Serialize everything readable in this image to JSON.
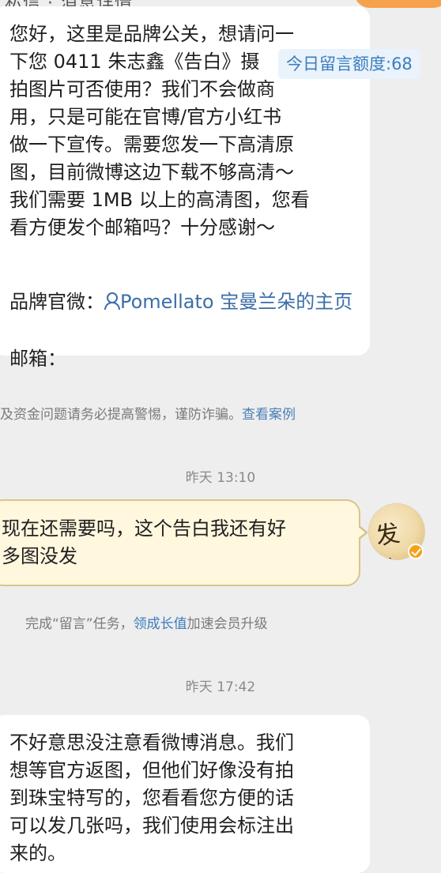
{
  "header": {
    "cut_text": "私信 · 消息详情",
    "accent_color": "#f6a24a"
  },
  "messages": {
    "m1": {
      "text": "您好，这里是品牌公关，想请问一\n下您 0411 朱志鑫《告白》摄\n拍图片可否使用？我们不会做商\n用，只是可能在官博/官方小红书\n做一下宣传。需要您发一下高清原\n图，目前微博这边下载不够高清～\n我们需要 1MB 以上的高清图，您看\n看方便发个邮箱吗？十分感谢～",
      "brand_label": "品牌官微：",
      "brand_link": "Pomellato 宝曼兰朵的主页",
      "email_label": "邮箱："
    },
    "m2": {
      "text": "现在还需要吗，这个告白我还有好\n多图没发"
    },
    "m3": {
      "text": "不好意思没注意看微博消息。我们\n想等官方返图，但他们好像没有拍\n到珠宝特写的，您看看您方便的话\n可以发几张吗，我们使用会标注出\n来的。"
    }
  },
  "quota": {
    "label": "今日留言额度:68"
  },
  "notice": {
    "text": "及资金问题请务必提高警惕，谨防诈骗。",
    "link": "查看案例"
  },
  "times": {
    "t1": "昨天 13:10",
    "t2": "昨天 17:42"
  },
  "task": {
    "prefix": "完成“留言”任务，",
    "link": "领成长值",
    "suffix": "加速会员升级"
  },
  "avatar": {
    "glyph": "发布"
  },
  "colors": {
    "link": "#3b6ea8",
    "outgoing_bubble": "#fff7de",
    "verified_badge": "#f4a21b"
  }
}
